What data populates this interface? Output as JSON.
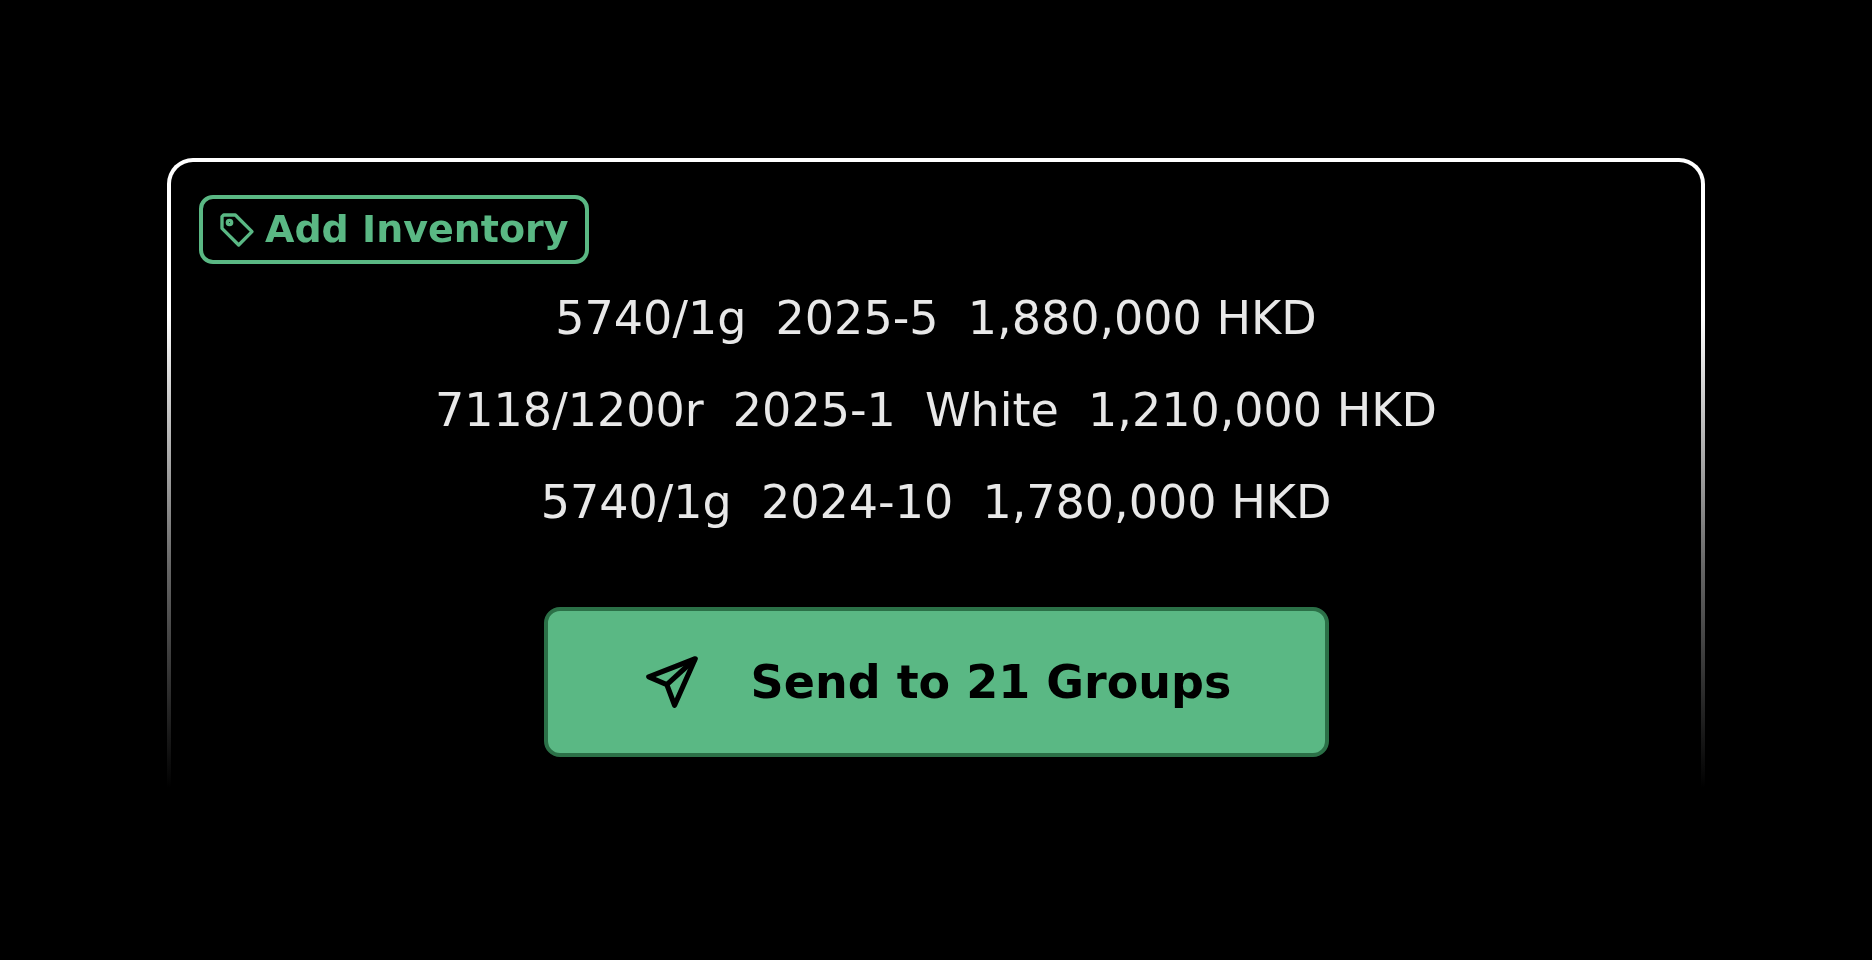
{
  "tag_button": {
    "label": "Add Inventory"
  },
  "listings": [
    "5740/1g  2025-5  1,880,000 HKD",
    "7118/1200r  2025-1  White  1,210,000 HKD",
    "5740/1g  2024-10  1,780,000 HKD"
  ],
  "send_button": {
    "label": "Send to 21 Groups"
  }
}
